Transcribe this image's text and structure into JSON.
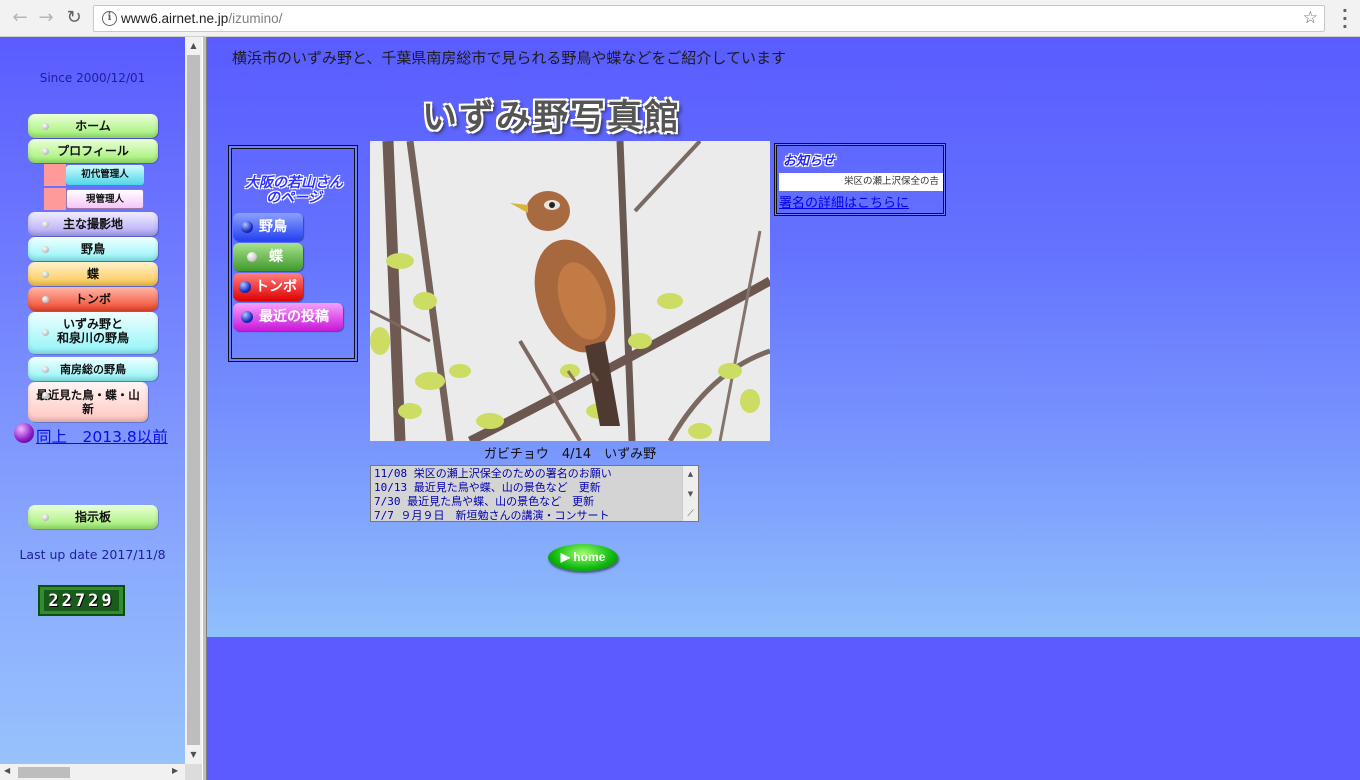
{
  "browser": {
    "url_host": "www6.airnet.ne.jp",
    "url_path": "/izumino/"
  },
  "left": {
    "since": "Since 2000/12/01",
    "menu": [
      {
        "label": "ホーム",
        "color": "green"
      },
      {
        "label": "プロフィール",
        "color": "green"
      },
      {
        "label": "主な撮影地",
        "color": "lav"
      },
      {
        "label": "野鳥",
        "color": "cyan"
      },
      {
        "label": "蝶",
        "color": "orange"
      },
      {
        "label": "トンボ",
        "color": "red"
      },
      {
        "label": "いずみ野と\n和泉川の野鳥",
        "color": "cyan"
      },
      {
        "label": "南房総の野鳥",
        "color": "cyan"
      },
      {
        "label": "最近見た鳥・蝶・山\n新",
        "color": "pink"
      },
      {
        "label": "指示板",
        "color": "green"
      }
    ],
    "submenu": [
      "初代管理人",
      "現管理人"
    ],
    "same_link": "同上　2013.8以前",
    "last_update": "Last up date  2017/11/8",
    "counter": "22729"
  },
  "main": {
    "tagline": "横浜市のいずみ野と、千葉県南房総市で見られる野鳥や蝶などをご紹介しています",
    "site_title": "いずみ野写真館",
    "wakayama_title": "大阪の若山さん\nのページ",
    "wakayama_buttons": [
      "野鳥",
      "蝶",
      "トンボ",
      "最近の投稿"
    ],
    "photo_caption": "ガビチョウ　4/14　いずみ野",
    "notice_label": "お知らせ",
    "notice_marquee": "栄区の瀬上沢保全の𠮷",
    "notice_link": "署名の詳細はこちらに",
    "news": [
      "11/08  栄区の瀬上沢保全のための署名のお願い",
      "10/13  最近見た鳥や蝶、山の景色など　更新",
      "7/30  最近見た鳥や蝶、山の景色など　更新",
      "7/7   ９月９日　新垣勉さんの講演・コンサート"
    ],
    "home_label": "home"
  }
}
